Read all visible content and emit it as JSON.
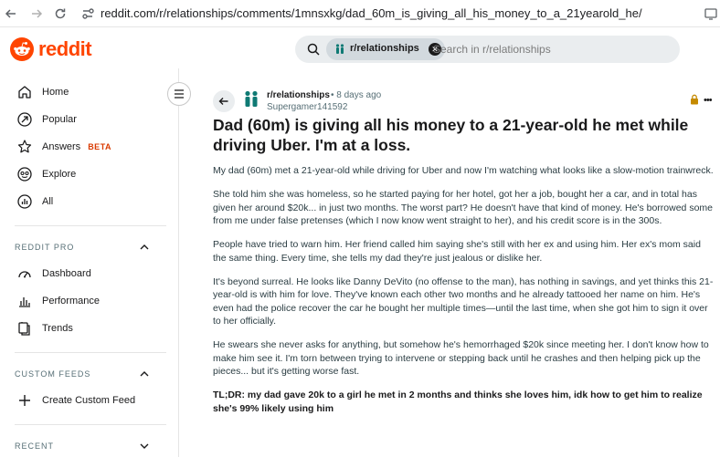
{
  "browser": {
    "url": "reddit.com/r/relationships/comments/1mnsxkg/dad_60m_is_giving_all_his_money_to_a_21yearold_he/"
  },
  "header": {
    "logo_text": "reddit",
    "search": {
      "chip_label": "r/relationships",
      "placeholder": "Search in r/relationships"
    }
  },
  "sidebar": {
    "nav": [
      {
        "label": "Home",
        "icon": "home-icon"
      },
      {
        "label": "Popular",
        "icon": "popular-icon"
      },
      {
        "label": "Answers",
        "badge": "BETA",
        "icon": "answers-icon"
      },
      {
        "label": "Explore",
        "icon": "explore-icon"
      },
      {
        "label": "All",
        "icon": "all-icon"
      }
    ],
    "sections": {
      "reddit_pro": {
        "label": "REDDIT PRO",
        "items": [
          {
            "label": "Dashboard",
            "icon": "dashboard-icon"
          },
          {
            "label": "Performance",
            "icon": "performance-icon"
          },
          {
            "label": "Trends",
            "icon": "trends-icon"
          }
        ]
      },
      "custom_feeds": {
        "label": "CUSTOM FEEDS",
        "items": [
          {
            "label": "Create Custom Feed",
            "icon": "plus-icon"
          }
        ]
      },
      "recent": {
        "label": "RECENT"
      }
    }
  },
  "post": {
    "subreddit": "r/relationships",
    "time": "• 8 days ago",
    "author": "Supergamer141592",
    "title": "Dad (60m) is giving all his money to a 21-year-old he met while driving Uber. I'm at a loss.",
    "paragraphs": [
      "My dad (60m) met a 21-year-old while driving for Uber and now I'm watching what looks like a slow-motion trainwreck.",
      "She told him she was homeless, so he started paying for her hotel, got her a job, bought her a car, and in total has given her around $20k... in just two months. The worst part? He doesn't have that kind of money. He's borrowed some from me under false pretenses (which I now know went straight to her), and his credit score is in the 300s.",
      "People have tried to warn him. Her friend called him saying she's still with her ex and using him. Her ex's mom said the same thing. Every time, she tells my dad they're just jealous or dislike her.",
      "It's beyond surreal. He looks like Danny DeVito (no offense to the man), has nothing in savings, and yet thinks this 21-year-old is with him for love. They've known each other two months and he already tattooed her name on him. He's even had the police recover the car he bought her multiple times—until the last time, when she got him to sign it over to her officially.",
      "He swears she never asks for anything, but somehow he's hemorrhaged $20k since meeting her. I don't know how to make him see it. I'm torn between trying to intervene or stepping back until he crashes and then helping pick up the pieces... but it's getting worse fast."
    ],
    "tldr": "TL;DR: my dad gave 20k to a girl he met in 2 months and thinks she loves him, idk how to get him to realize she's 99% likely using him"
  },
  "colors": {
    "brand": "#ff4500",
    "beta": "#d93a00",
    "search_bg": "#eaedef",
    "chip_bg": "#d2d9de",
    "subreddit_icon": "#0f7a74"
  }
}
